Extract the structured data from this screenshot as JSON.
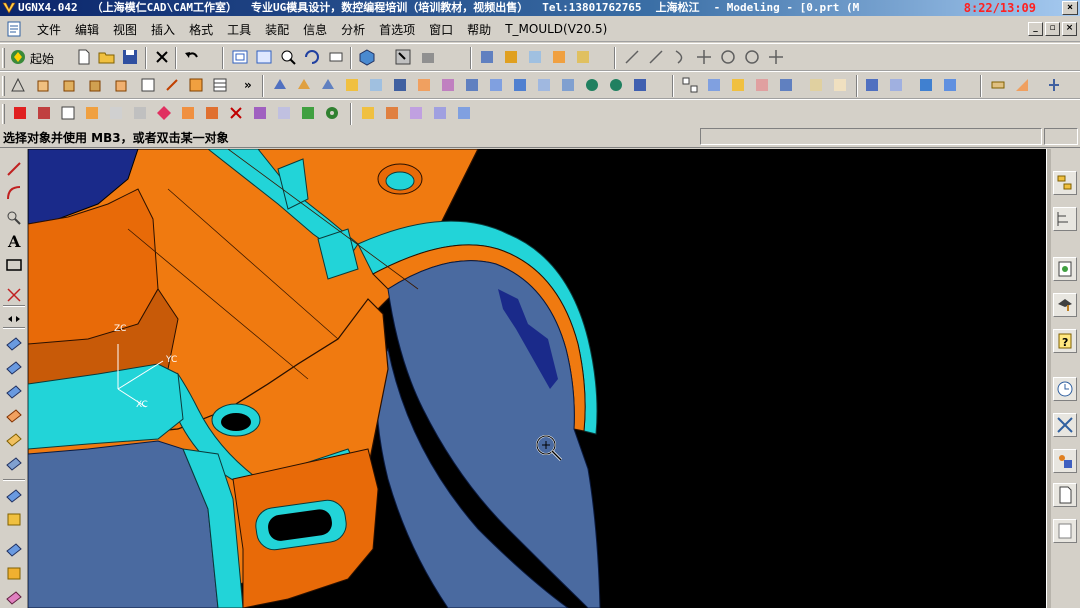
{
  "window": {
    "title_parts": [
      "UGNX4.042",
      "（上海模仁CAD\\CAM工作室）",
      "专业UG模具设计，数控编程培训（培训教材，视频出售）",
      "Tel:13801762765",
      "上海松江",
      "- Modeling - [0.prt (M"
    ],
    "clock": "8:22/13:09",
    "controls": [
      "_",
      "□",
      "×"
    ]
  },
  "menubar": {
    "items": [
      "文件",
      "编辑",
      "视图",
      "插入",
      "格式",
      "工具",
      "装配",
      "信息",
      "分析",
      "首选项",
      "窗口",
      "帮助",
      "T_MOULD(V20.5)"
    ],
    "mdi_controls": [
      "_",
      "▫",
      "×"
    ]
  },
  "toolbar": {
    "start_label": "起始",
    "overflow_glyph": "»"
  },
  "statusbar": {
    "prompt": "选择对象并使用 MB3，或者双击某一对象"
  },
  "viewport": {
    "wcs_labels": {
      "z": "ZC",
      "y": "YC",
      "x": "XC"
    },
    "colors": {
      "background": "#000000",
      "orange": "#f07a10",
      "cyan": "#22d4d8",
      "slate": "#4a6aa0",
      "dark_blue": "#1a2a8a"
    }
  },
  "icons": {
    "new": "new-file-icon",
    "open": "open-folder-icon",
    "save": "save-icon",
    "undo": "undo-icon",
    "fit": "fit-view-icon",
    "zoom": "zoom-icon",
    "rotate": "rotate-icon",
    "line": "line-icon",
    "point": "point-icon",
    "cursor": "zoom-cursor-icon"
  }
}
